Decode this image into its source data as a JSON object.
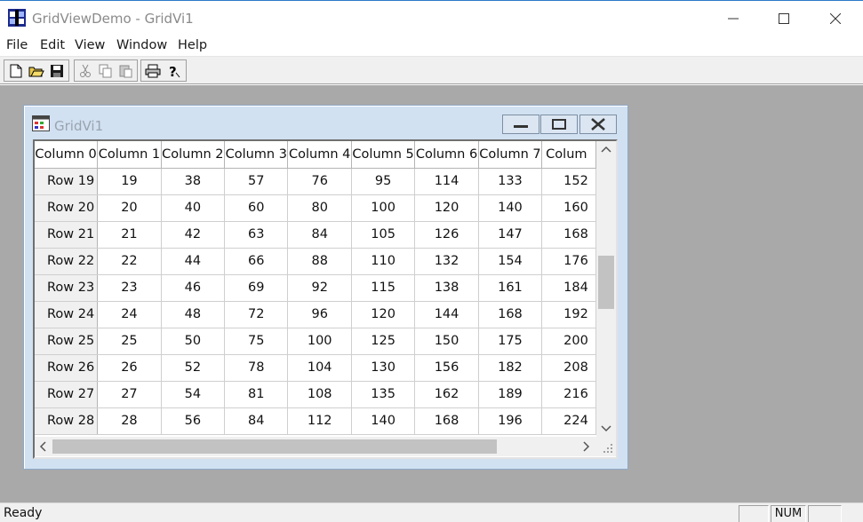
{
  "window": {
    "title": "GridViewDemo - GridVi1"
  },
  "menu": {
    "items": [
      "File",
      "Edit",
      "View",
      "Window",
      "Help"
    ]
  },
  "toolbar": {
    "buttons": [
      "new-document-icon",
      "open-folder-icon",
      "save-disk-icon",
      "cut-scissors-icon",
      "copy-icon",
      "paste-clipboard-icon",
      "print-icon",
      "help-question-icon"
    ]
  },
  "child": {
    "title": "GridVi1"
  },
  "grid": {
    "columns": [
      "Column 0",
      "Column 1",
      "Column 2",
      "Column 3",
      "Column 4",
      "Column 5",
      "Column 6",
      "Column 7",
      "Colum"
    ],
    "rows": [
      {
        "label": "Row 19",
        "cells": [
          "19",
          "38",
          "57",
          "76",
          "95",
          "114",
          "133",
          "152"
        ]
      },
      {
        "label": "Row 20",
        "cells": [
          "20",
          "40",
          "60",
          "80",
          "100",
          "120",
          "140",
          "160"
        ]
      },
      {
        "label": "Row 21",
        "cells": [
          "21",
          "42",
          "63",
          "84",
          "105",
          "126",
          "147",
          "168"
        ]
      },
      {
        "label": "Row 22",
        "cells": [
          "22",
          "44",
          "66",
          "88",
          "110",
          "132",
          "154",
          "176"
        ]
      },
      {
        "label": "Row 23",
        "cells": [
          "23",
          "46",
          "69",
          "92",
          "115",
          "138",
          "161",
          "184"
        ]
      },
      {
        "label": "Row 24",
        "cells": [
          "24",
          "48",
          "72",
          "96",
          "120",
          "144",
          "168",
          "192"
        ]
      },
      {
        "label": "Row 25",
        "cells": [
          "25",
          "50",
          "75",
          "100",
          "125",
          "150",
          "175",
          "200"
        ]
      },
      {
        "label": "Row 26",
        "cells": [
          "26",
          "52",
          "78",
          "104",
          "130",
          "156",
          "182",
          "208"
        ]
      },
      {
        "label": "Row 27",
        "cells": [
          "27",
          "54",
          "81",
          "108",
          "135",
          "162",
          "189",
          "216"
        ]
      },
      {
        "label": "Row 28",
        "cells": [
          "28",
          "56",
          "84",
          "112",
          "140",
          "168",
          "196",
          "224"
        ]
      }
    ]
  },
  "status": {
    "text": "Ready",
    "num": "NUM"
  }
}
